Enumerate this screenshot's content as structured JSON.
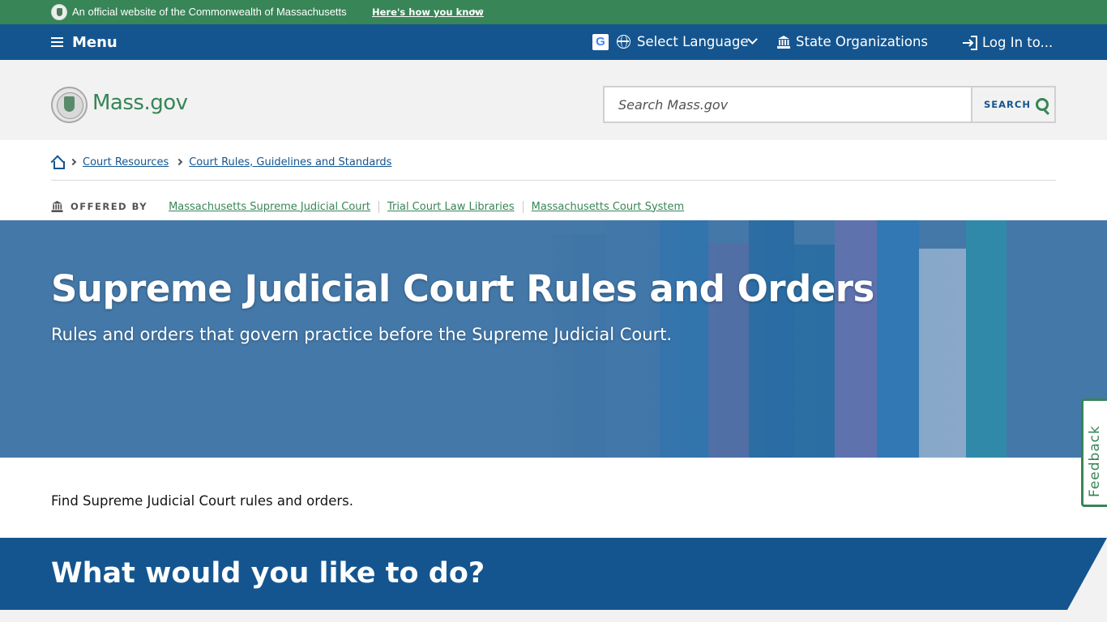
{
  "official_bar": {
    "text": "An official website of the Commonwealth of Massachusetts",
    "how_link": "Here's how you know"
  },
  "nav": {
    "menu_label": "Menu",
    "google_letter": "G",
    "language_label": "Select Language",
    "state_orgs_label": "State Organizations",
    "login_label": "Log In to..."
  },
  "header": {
    "logo_text": "Mass.gov",
    "search_placeholder": "Search Mass.gov",
    "search_button": "SEARCH"
  },
  "breadcrumb": {
    "items": [
      "Court Resources",
      "Court Rules, Guidelines and Standards"
    ]
  },
  "offered_by": {
    "label": "OFFERED BY",
    "orgs": [
      "Massachusetts Supreme Judicial Court",
      "Trial Court Law Libraries",
      "Massachusetts Court System"
    ]
  },
  "hero": {
    "title": "Supreme Judicial Court Rules and Orders",
    "subtitle": "Rules and orders that govern practice before the Supreme Judicial Court."
  },
  "intro_text": "Find Supreme Judicial Court rules and orders.",
  "feedback_label": "Feedback",
  "action_heading": "What would you like to do?",
  "colors": {
    "green": "#388557",
    "blue": "#14558f",
    "hero_blue": "#4478a8",
    "light_gray": "#f2f2f2"
  }
}
